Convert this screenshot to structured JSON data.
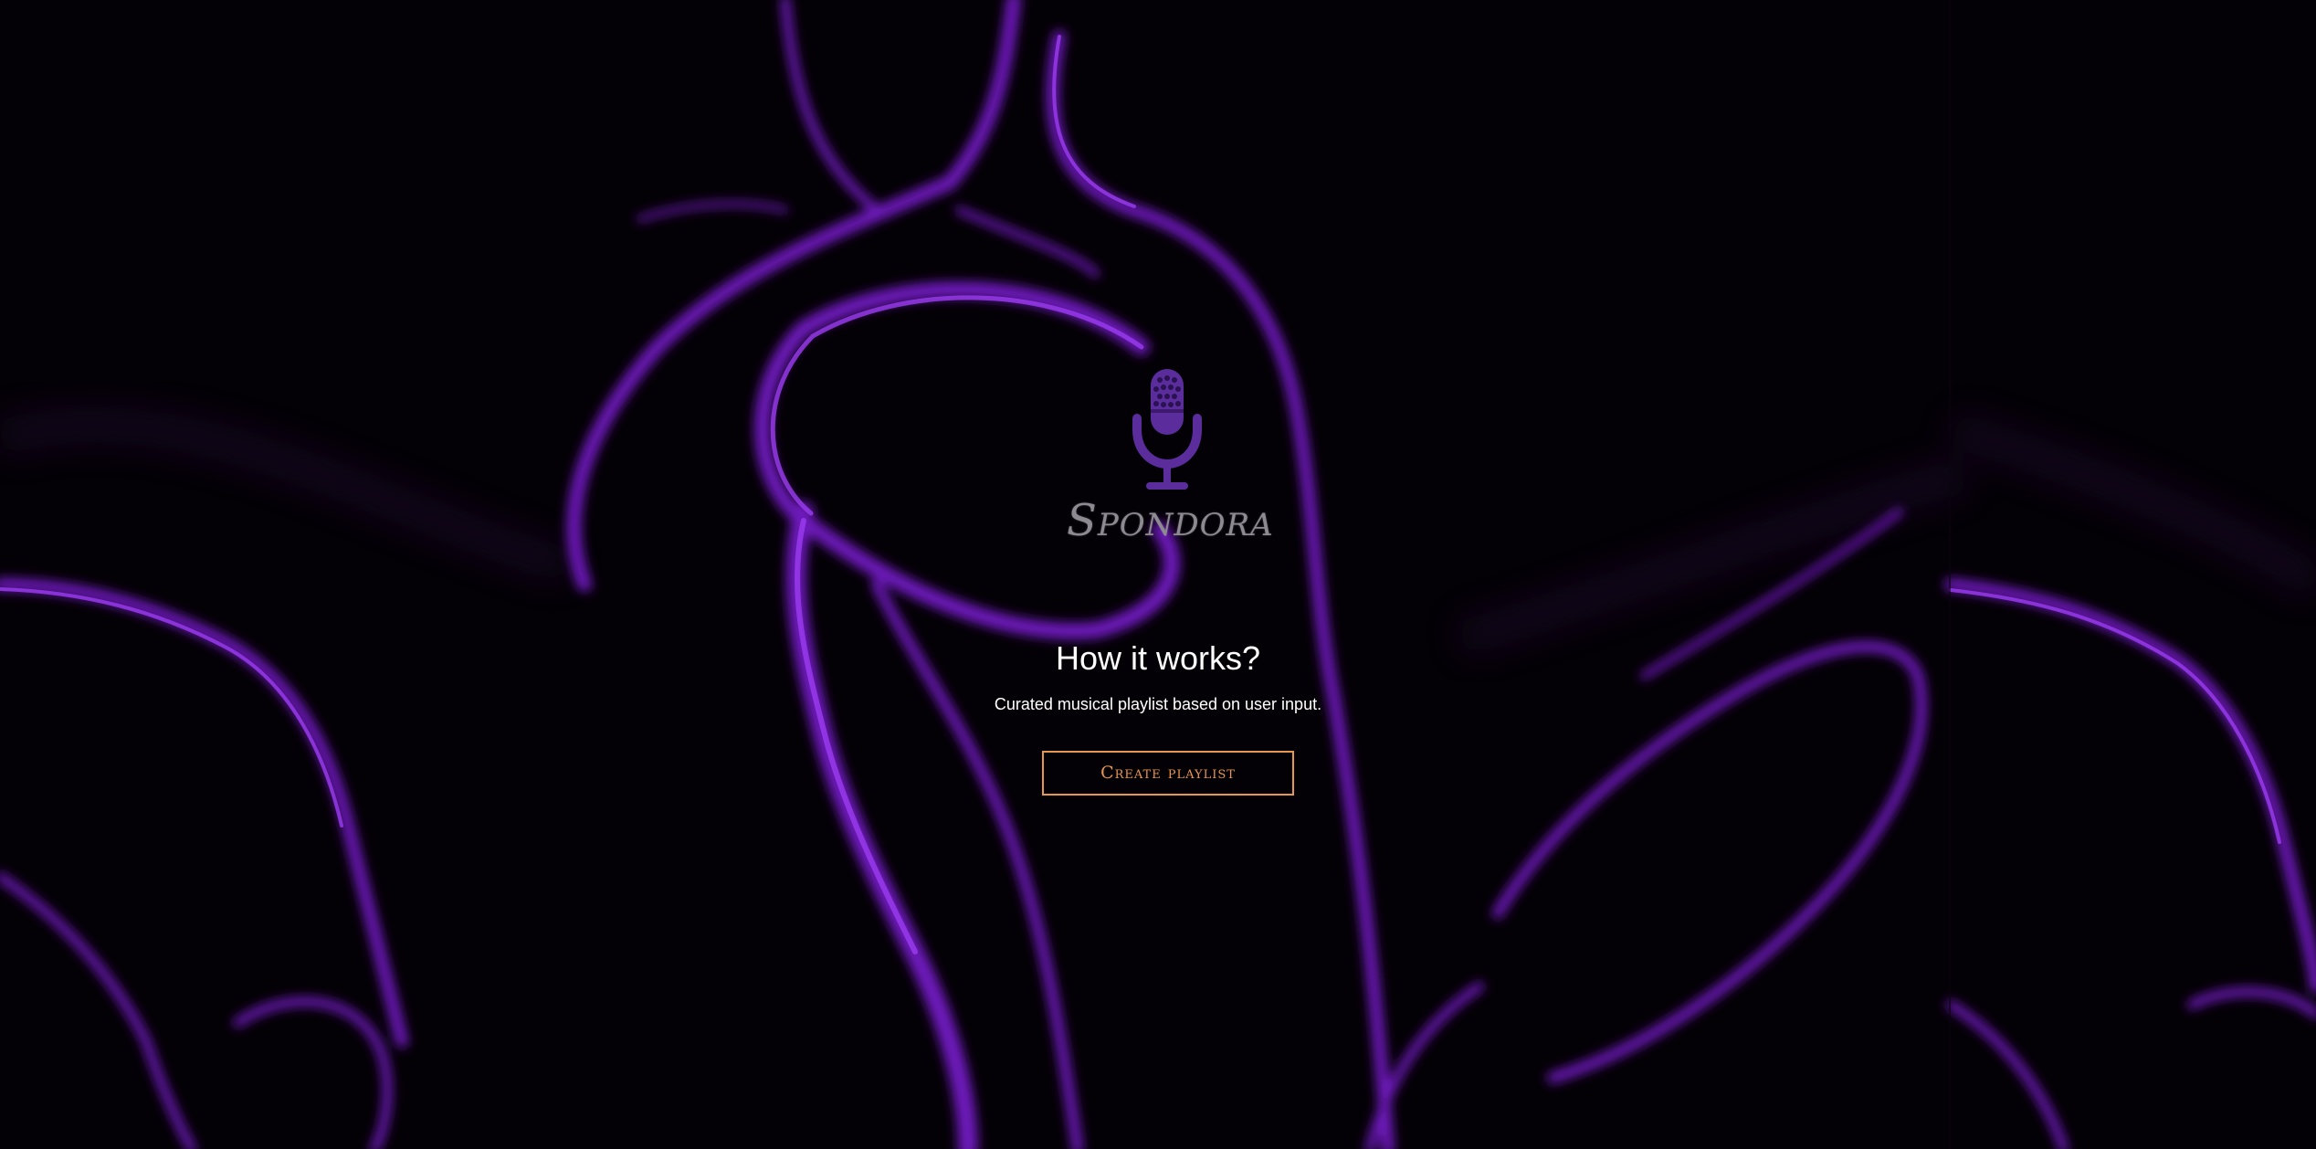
{
  "brand": {
    "name": "Spondora",
    "logo_icon": "microphone-icon",
    "logo_color": "#5b2d9c"
  },
  "hero": {
    "heading": "How it works?",
    "subtitle": "Curated musical playlist based on user input.",
    "cta_label": "Create playlist"
  },
  "theme": {
    "background": "#050107",
    "accent_purple": "#7a1fd0",
    "accent_orange": "#e8954f",
    "text_color": "#ffffff"
  }
}
